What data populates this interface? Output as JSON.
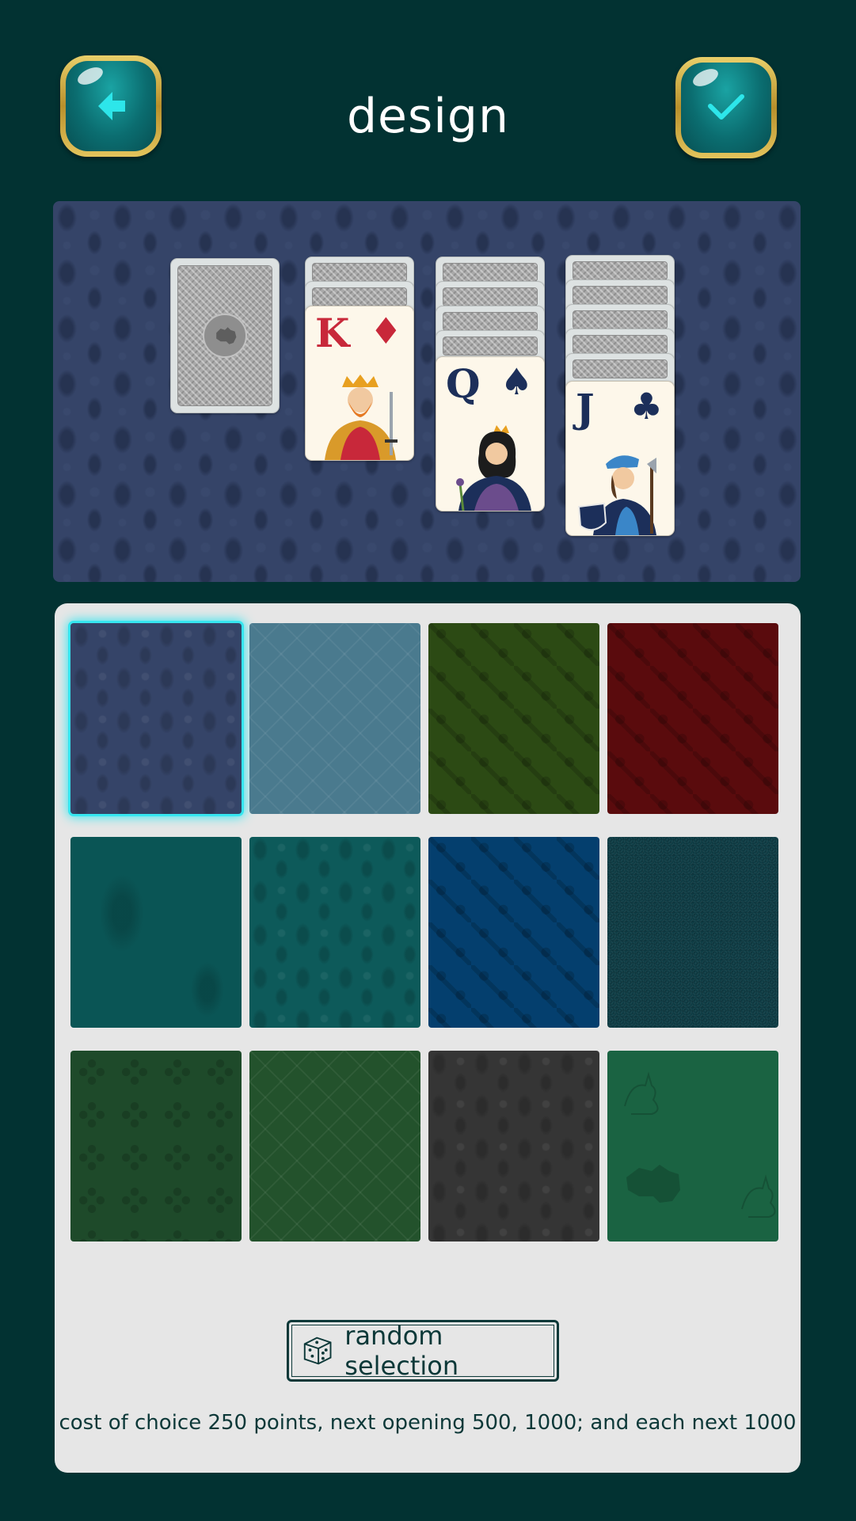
{
  "header": {
    "title": "design",
    "back_icon": "arrow-left-icon",
    "confirm_icon": "checkmark-icon",
    "button_color": "#0b6d70",
    "button_frame_color": "#d6b44c"
  },
  "preview": {
    "background": "navy-damask",
    "stock_emblem": "australia-map-icon",
    "tableau": [
      {
        "face_down": 2,
        "rank": "K",
        "suit": "♦",
        "suit_name": "diamonds",
        "color": "#c8283a"
      },
      {
        "face_down": 4,
        "rank": "Q",
        "suit": "♠",
        "suit_name": "spades",
        "color": "#1c2f5a"
      },
      {
        "face_down": 5,
        "rank": "J",
        "suit": "♣",
        "suit_name": "clubs",
        "color": "#1c2f5a"
      }
    ]
  },
  "designs": [
    {
      "name": "navy-damask",
      "color": "#354468",
      "selected": true
    },
    {
      "name": "steel-blue-lattice",
      "color": "#4a7a8e",
      "selected": false
    },
    {
      "name": "olive-card-suits",
      "color": "#2c4a14",
      "selected": false
    },
    {
      "name": "burgundy-card-suits",
      "color": "#5a0b0d",
      "selected": false
    },
    {
      "name": "teal-floral",
      "color": "#0a5555",
      "selected": false
    },
    {
      "name": "teal-damask",
      "color": "#0d5a5a",
      "selected": false
    },
    {
      "name": "blue-card-suits",
      "color": "#043f6e",
      "selected": false
    },
    {
      "name": "teal-felt",
      "color": "#0f3d45",
      "selected": false
    },
    {
      "name": "green-quatrefoil",
      "color": "#1e4a2a",
      "selected": false
    },
    {
      "name": "green-diamond-lattice",
      "color": "#23522c",
      "selected": false
    },
    {
      "name": "charcoal-damask",
      "color": "#353535",
      "selected": false
    },
    {
      "name": "green-kangaroo",
      "color": "#1a6342",
      "selected": false
    }
  ],
  "random_button": {
    "label": "random selection",
    "icon": "dice-icon"
  },
  "cost_text": "cost of choice 250 points, next opening 500, 1000; and each next 1000"
}
